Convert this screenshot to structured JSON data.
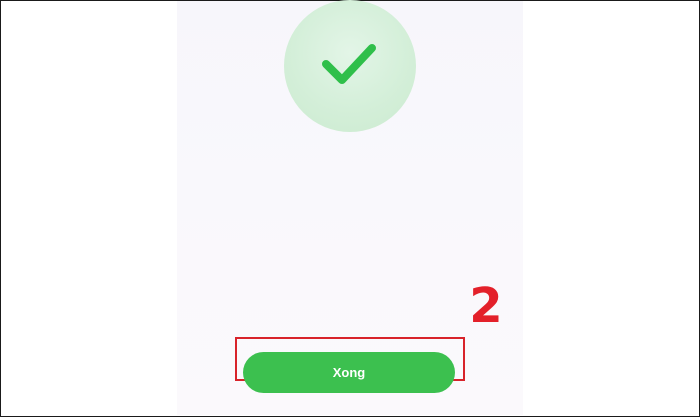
{
  "success_screen": {
    "check_icon": "checkmark-icon",
    "done_button_label": "Xong"
  },
  "annotation": {
    "step_number": "2",
    "highlight_color": "#d8232a"
  },
  "colors": {
    "accent_green": "#3cc04f",
    "check_green": "#2fbf4a",
    "circle_bg": "#d4efd9",
    "annotation_red": "#e3202a"
  }
}
